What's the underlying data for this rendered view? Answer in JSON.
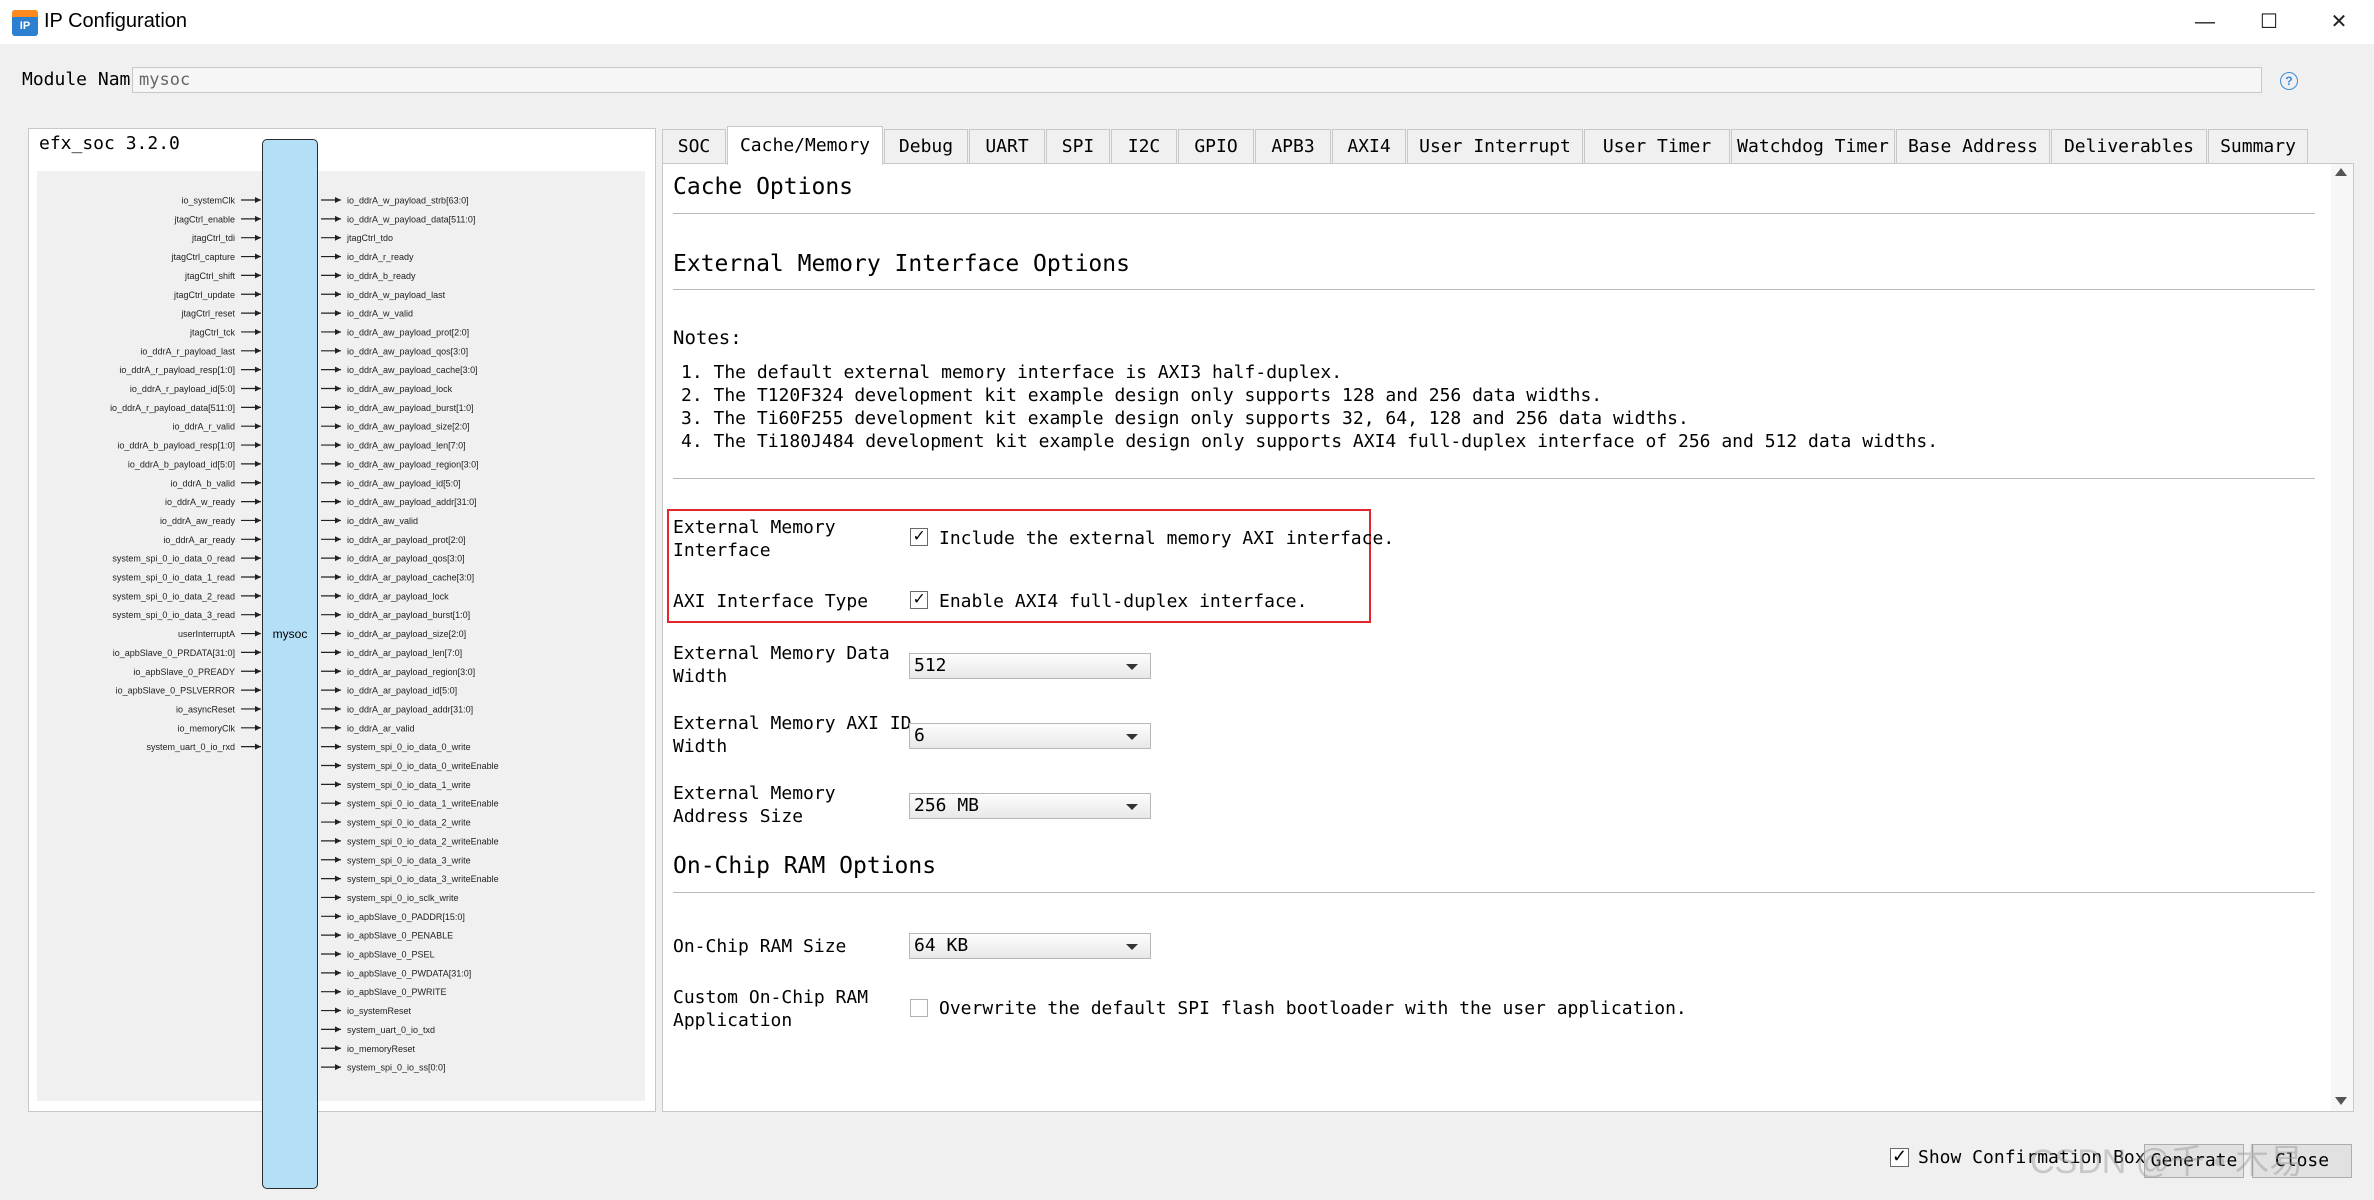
{
  "window": {
    "title": "IP Configuration",
    "icon_text": "IP",
    "minimize": "—",
    "maximize": "☐",
    "close": "✕"
  },
  "module": {
    "label": "Module Nam",
    "value": "mysoc",
    "help": "?"
  },
  "left_panel": {
    "title": "efx_soc 3.2.0",
    "block_name": "mysoc",
    "left_ports": [
      "io_systemClk",
      "jtagCtrl_enable",
      "jtagCtrl_tdi",
      "jtagCtrl_capture",
      "jtagCtrl_shift",
      "jtagCtrl_update",
      "jtagCtrl_reset",
      "jtagCtrl_tck",
      "io_ddrA_r_payload_last",
      "io_ddrA_r_payload_resp[1:0]",
      "io_ddrA_r_payload_id[5:0]",
      "io_ddrA_r_payload_data[511:0]",
      "io_ddrA_r_valid",
      "io_ddrA_b_payload_resp[1:0]",
      "io_ddrA_b_payload_id[5:0]",
      "io_ddrA_b_valid",
      "io_ddrA_w_ready",
      "io_ddrA_aw_ready",
      "io_ddrA_ar_ready",
      "system_spi_0_io_data_0_read",
      "system_spi_0_io_data_1_read",
      "system_spi_0_io_data_2_read",
      "system_spi_0_io_data_3_read",
      "userInterruptA",
      "io_apbSlave_0_PRDATA[31:0]",
      "io_apbSlave_0_PREADY",
      "io_apbSlave_0_PSLVERROR",
      "io_asyncReset",
      "io_memoryClk",
      "system_uart_0_io_rxd"
    ],
    "right_ports": [
      "io_ddrA_w_payload_strb[63:0]",
      "io_ddrA_w_payload_data[511:0]",
      "jtagCtrl_tdo",
      "io_ddrA_r_ready",
      "io_ddrA_b_ready",
      "io_ddrA_w_payload_last",
      "io_ddrA_w_valid",
      "io_ddrA_aw_payload_prot[2:0]",
      "io_ddrA_aw_payload_qos[3:0]",
      "io_ddrA_aw_payload_cache[3:0]",
      "io_ddrA_aw_payload_lock",
      "io_ddrA_aw_payload_burst[1:0]",
      "io_ddrA_aw_payload_size[2:0]",
      "io_ddrA_aw_payload_len[7:0]",
      "io_ddrA_aw_payload_region[3:0]",
      "io_ddrA_aw_payload_id[5:0]",
      "io_ddrA_aw_payload_addr[31:0]",
      "io_ddrA_aw_valid",
      "io_ddrA_ar_payload_prot[2:0]",
      "io_ddrA_ar_payload_qos[3:0]",
      "io_ddrA_ar_payload_cache[3:0]",
      "io_ddrA_ar_payload_lock",
      "io_ddrA_ar_payload_burst[1:0]",
      "io_ddrA_ar_payload_size[2:0]",
      "io_ddrA_ar_payload_len[7:0]",
      "io_ddrA_ar_payload_region[3:0]",
      "io_ddrA_ar_payload_id[5:0]",
      "io_ddrA_ar_payload_addr[31:0]",
      "io_ddrA_ar_valid",
      "system_spi_0_io_data_0_write",
      "system_spi_0_io_data_0_writeEnable",
      "system_spi_0_io_data_1_write",
      "system_spi_0_io_data_1_writeEnable",
      "system_spi_0_io_data_2_write",
      "system_spi_0_io_data_2_writeEnable",
      "system_spi_0_io_data_3_write",
      "system_spi_0_io_data_3_writeEnable",
      "system_spi_0_io_sclk_write",
      "io_apbSlave_0_PADDR[15:0]",
      "io_apbSlave_0_PENABLE",
      "io_apbSlave_0_PSEL",
      "io_apbSlave_0_PWDATA[31:0]",
      "io_apbSlave_0_PWRITE",
      "io_systemReset",
      "system_uart_0_io_txd",
      "io_memoryReset",
      "system_spi_0_io_ss[0:0]"
    ]
  },
  "tabs": [
    "SOC",
    "Cache/Memory",
    "Debug",
    "UART",
    "SPI",
    "I2C",
    "GPIO",
    "APB3",
    "AXI4",
    "User Interrupt",
    "User Timer",
    "Watchdog Timer",
    "Base Address",
    "Deliverables",
    "Summary"
  ],
  "active_tab": "Cache/Memory",
  "content": {
    "cache_title": "Cache Options",
    "ext_mem_title": "External Memory Interface Options",
    "notes_label": "Notes:",
    "notes": [
      "1. The default external memory interface is AXI3 half-duplex.",
      "2. The T120F324 development kit example design only supports 128 and 256 data widths.",
      "3. The Ti60F255 development kit example design only supports 32, 64, 128 and 256 data widths.",
      "4. The Ti180J484 development kit example design only supports AXI4 full-duplex interface of 256 and 512 data widths."
    ],
    "ext_mem_iface_label_1": "External Memory",
    "ext_mem_iface_label_2": "Interface",
    "ext_mem_iface_checkbox": "Include the external memory AXI interface.",
    "axi_type_label": "AXI Interface Type",
    "axi_type_checkbox": "Enable AXI4 full-duplex interface.",
    "data_width_label_1": "External Memory Data",
    "data_width_label_2": "Width",
    "data_width_value": "512",
    "id_width_label_1": "External Memory AXI ID",
    "id_width_label_2": "Width",
    "id_width_value": "6",
    "addr_size_label_1": "External Memory",
    "addr_size_label_2": "Address Size",
    "addr_size_value": "256 MB",
    "onchip_title": "On-Chip RAM Options",
    "ram_size_label": "On-Chip RAM Size",
    "ram_size_value": "64 KB",
    "custom_ram_label_1": "Custom On-Chip RAM",
    "custom_ram_label_2": "Application",
    "custom_ram_checkbox": "Overwrite the default SPI flash bootloader with the user application.",
    "check_glyph": "✓"
  },
  "footer": {
    "show_confirmation": "Show Confirmation Box",
    "generate": "Generate",
    "close": "Close",
    "watermark": "CSDN @千 • 木易"
  }
}
